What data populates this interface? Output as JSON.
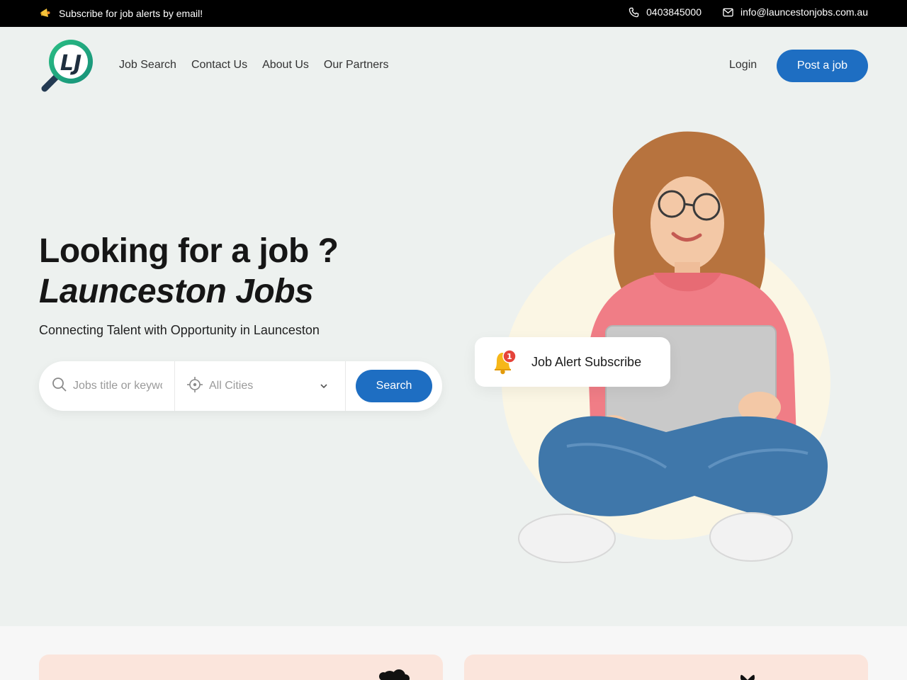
{
  "topbar": {
    "subscribe_text": "Subscribe for job alerts by email!",
    "subscribe_icon": "megaphone-icon",
    "phone": "0403845000",
    "phone_icon": "phone-icon",
    "email": "info@launcestonjobs.com.au",
    "email_icon": "mail-icon"
  },
  "header": {
    "logo_text": "LJ",
    "nav": [
      "Job Search",
      "Contact Us",
      "About Us",
      "Our Partners"
    ],
    "login": "Login",
    "post_job": "Post a job"
  },
  "hero": {
    "title_line1": "Looking for a job ?",
    "title_line2": "Launceston Jobs",
    "subtitle": "Connecting Talent with Opportunity in Launceston",
    "search": {
      "keyword_placeholder": "Jobs title or keyword",
      "city_selected": "All Cities",
      "button": "Search"
    },
    "alert_card": {
      "label": "Job Alert Subscribe",
      "badge_count": "1"
    }
  },
  "colors": {
    "accent": "#1e6ec2",
    "logo_green": "#1fa879",
    "card_peach": "#fbe5dc"
  }
}
